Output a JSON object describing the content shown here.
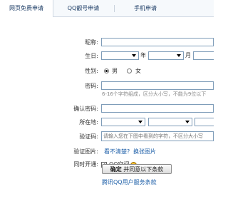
{
  "tabs": [
    {
      "label": "网页免费申请"
    },
    {
      "label": "QQ靓号申请"
    },
    {
      "label": "手机申请"
    }
  ],
  "form": {
    "nickname_label": "昵称:",
    "birthday_label": "生日:",
    "year_unit": "年",
    "month_unit": "月",
    "gender_label": "性别:",
    "gender_male": "男",
    "gender_female": "女",
    "password_label": "密码:",
    "password_hint": "6-16个字符组成，区分大小写，不能为9位以下",
    "confirm_label": "确认密码:",
    "location_label": "所在地:",
    "captcha_label": "验证码:",
    "captcha_placeholder": "请输入您在下图中看到的字符，不区分大小写",
    "captcha_image_label": "验证图片:",
    "captcha_unclear": "看不清楚?",
    "captcha_change": "换张图片",
    "activate_label": "同时开通:",
    "qq_space": "QQ空间",
    "submit_confirm": "确定",
    "submit_agree": "并同意以下条款",
    "terms_link": "腾讯QQ用户服务条款"
  }
}
